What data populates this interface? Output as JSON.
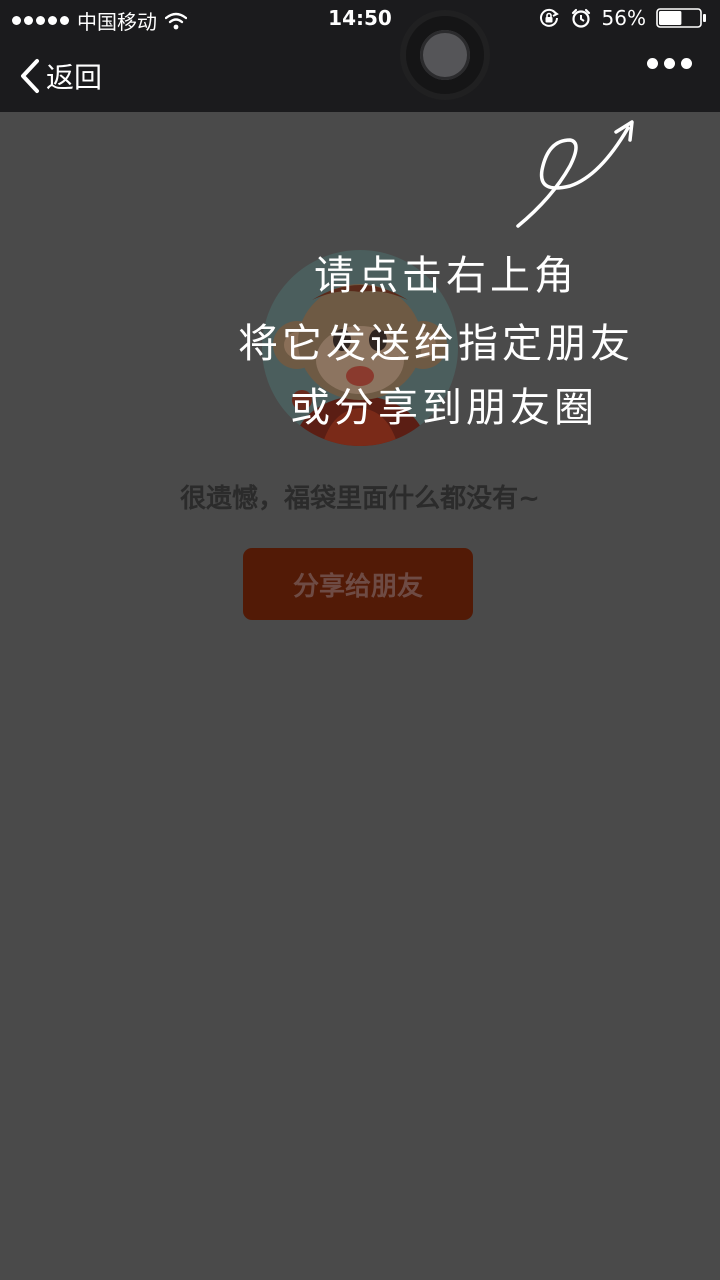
{
  "status_bar": {
    "carrier": "中国移动",
    "time": "14:50",
    "battery_percent": "56%",
    "battery_level": 0.56,
    "signal_bars": 5,
    "icons": [
      "signal-dots-icon",
      "wifi-icon",
      "rotation-lock-icon",
      "alarm-icon",
      "battery-icon"
    ]
  },
  "nav": {
    "back_label": "返回",
    "more_icon": "more-dots-icon"
  },
  "content": {
    "message": "很遗憾，福袋里面什么都没有~",
    "share_button_label": "分享给朋友"
  },
  "guide_overlay": {
    "line1": "请点击右上角",
    "line2": "将它发送给指定朋友",
    "line3": "或分享到朋友圈"
  },
  "colors": {
    "background": "#4a4a4a",
    "bar": "#1b1b1d",
    "button": "#521a06",
    "button_text": "#6e4b44",
    "message_text": "#2b2b2b"
  }
}
